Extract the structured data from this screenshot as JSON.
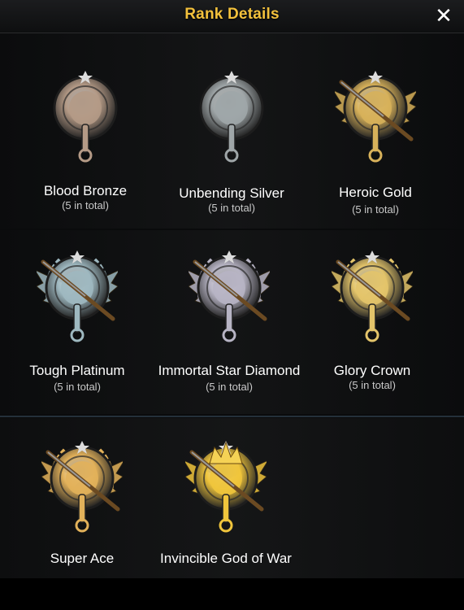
{
  "header": {
    "title": "Rank Details",
    "close_symbol": "✕"
  },
  "ranks": [
    {
      "name": "Blood Bronze",
      "count": "(5 in total)",
      "color": "#b49a86",
      "icon": "bronze-pan-badge-icon"
    },
    {
      "name": "Unbending Silver",
      "count": "(5 in total)",
      "color": "#9fa6a8",
      "icon": "silver-pan-badge-icon"
    },
    {
      "name": "Heroic Gold",
      "count": "(5 in total)",
      "color": "#d7b15a",
      "icon": "gold-pan-badge-icon"
    },
    {
      "name": "Tough Platinum",
      "count": "(5 in total)",
      "color": "#9eb8c0",
      "icon": "platinum-badge-icon"
    },
    {
      "name": "Immortal Star Diamond",
      "count": "(5 in total)",
      "color": "#b7b4c4",
      "icon": "diamond-badge-icon"
    },
    {
      "name": "Glory Crown",
      "count": "(5 in total)",
      "color": "#e3c46a",
      "icon": "crown-badge-icon"
    },
    {
      "name": "Super Ace",
      "count": "",
      "color": "#e2b15a",
      "icon": "ace-badge-icon"
    },
    {
      "name": "Invincible God of War",
      "count": "",
      "color": "#f0c53c",
      "icon": "god-of-war-badge-icon"
    }
  ]
}
